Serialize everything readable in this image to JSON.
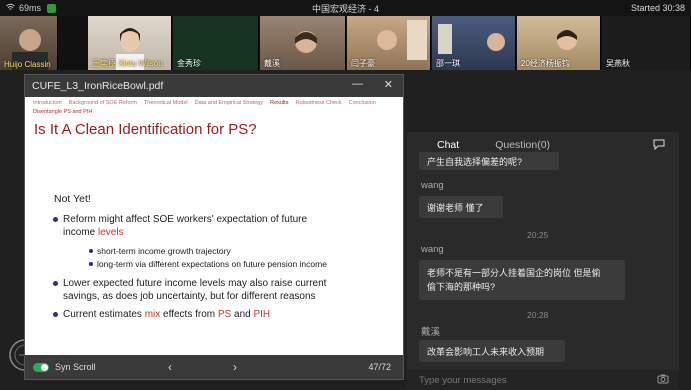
{
  "topbar": {
    "ping": "69ms",
    "title": "中国宏观经济 - 4",
    "timer": "Started 30:38"
  },
  "participants": [
    {
      "name": "Huijo Classin",
      "color": "#6b5a4a"
    },
    {
      "name": "王奕臣 Xintu Wilson",
      "color": "#cfc6b8"
    },
    {
      "name": "金秀珍",
      "color": "#1e3a24"
    },
    {
      "name": "戴溪",
      "color": "#8a7362"
    },
    {
      "name": "闫子豪",
      "color": "#a8896a"
    },
    {
      "name": "邵一琪",
      "color": "#3b4b6a"
    },
    {
      "name": "20经济杨振钧",
      "color": "#bba37e"
    },
    {
      "name": "吴燕秋",
      "color": "#262626"
    }
  ],
  "pdf": {
    "filename": "CUFE_L3_IronRiceBowl.pdf",
    "nav": [
      "Introduction",
      "Background of SOE Reform",
      "Theoretical Model",
      "Data and Empirical Strategy",
      "Results",
      "Robustness Check",
      "Conclusion"
    ],
    "subsection": "Disentangle PS and PIH",
    "slide_title": "Is It A Clean Identification for PS?",
    "not_yet": "Not Yet!",
    "b1_line1": "Reform might affect SOE workers' expectation of future",
    "b1_line2_a": "income ",
    "b1_line2_b": "levels",
    "s1": "short-term income growth trajectory",
    "s2": "long-term via different expectations on future pension income",
    "b2_line1": "Lower expected future income levels may also raise current",
    "b2_line2": "savings, as does job uncertainty, but for different reasons",
    "b3_a": "Current estimates ",
    "b3_b": "mix",
    "b3_c": " effects from ",
    "b3_d": "PS",
    "b3_e": " and ",
    "b3_f": "PIH",
    "syn_scroll": "Syn Scroll",
    "page": "47/72"
  },
  "chat": {
    "tab_chat": "Chat",
    "tab_question": "Question(0)",
    "m0": "产生自我选择偏差的呢?",
    "sender1": "wang",
    "m1": "谢谢老师 懂了",
    "t1": "20:25",
    "sender2": "wang",
    "m2_line1": "老师不是有一部分人挂着国企的岗位 但是偷",
    "m2_line2": "偷下海的那种吗?",
    "t2": "20:28",
    "sender3": "戴溪",
    "m3": "改革会影响工人未来收入预期",
    "placeholder": "Type your messages"
  },
  "colors": {
    "accent_red": "#9b1b1b",
    "bullet_blue": "#2c2c8c",
    "toggle_green": "#34a853"
  }
}
